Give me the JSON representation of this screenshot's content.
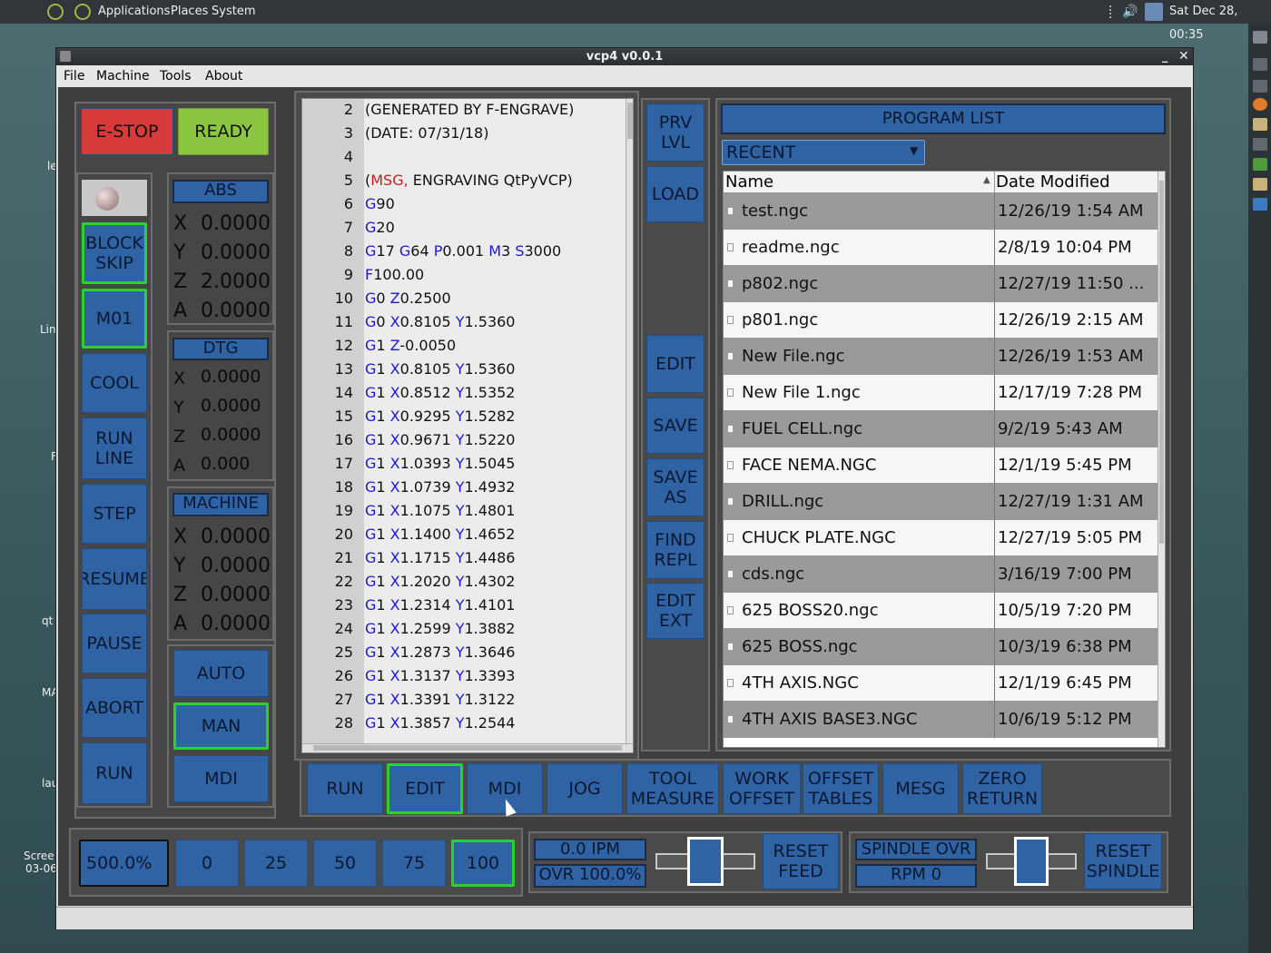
{
  "topbar": {
    "menus": [
      "Applications",
      "Places",
      "System"
    ],
    "clock": "Sat Dec 28, 00:35"
  },
  "desktop": {
    "labels": [
      "le",
      "Lin",
      "F",
      "qt",
      "MA",
      "lau",
      "Scree",
      "03-06"
    ]
  },
  "window": {
    "title": "vcp4 v0.0.1",
    "menus": [
      "File",
      "Machine",
      "Tools",
      "About"
    ]
  },
  "left": {
    "estop": "E-STOP",
    "ready": "READY",
    "buttons": [
      "BLOCK\nSKIP",
      "M01",
      "COOL",
      "RUN\nLINE",
      "STEP",
      "RESUME",
      "PAUSE",
      "ABORT",
      "RUN"
    ]
  },
  "dro": {
    "abs": {
      "title": "ABS",
      "rows": [
        [
          "X",
          "0.0000"
        ],
        [
          "Y",
          "0.0000"
        ],
        [
          "Z",
          "2.0000"
        ],
        [
          "A",
          "0.0000"
        ]
      ]
    },
    "dtg": {
      "title": "DTG",
      "rows": [
        [
          "X",
          "0.0000"
        ],
        [
          "Y",
          "0.0000"
        ],
        [
          "Z",
          "0.0000"
        ],
        [
          "A",
          "0.000"
        ]
      ]
    },
    "machine": {
      "title": "MACHINE",
      "rows": [
        [
          "X",
          "0.0000"
        ],
        [
          "Y",
          "0.0000"
        ],
        [
          "Z",
          "0.0000"
        ],
        [
          "A",
          "0.0000"
        ]
      ]
    }
  },
  "modes": [
    "AUTO",
    "MAN",
    "MDI"
  ],
  "gcode": [
    {
      "n": "2",
      "t": [
        [
          "",
          "(GENERATED BY F-ENGRAVE)"
        ]
      ]
    },
    {
      "n": "3",
      "t": [
        [
          "",
          "(DATE: 07/31/18)"
        ]
      ]
    },
    {
      "n": "4",
      "t": []
    },
    {
      "n": "5",
      "t": [
        [
          "",
          "("
        ],
        [
          "r",
          "MSG,"
        ],
        [
          "",
          " ENGRAVING QtPyVCP)"
        ]
      ]
    },
    {
      "n": "6",
      "t": [
        [
          "g",
          "G"
        ],
        [
          "",
          "90"
        ]
      ]
    },
    {
      "n": "7",
      "t": [
        [
          "g",
          "G"
        ],
        [
          "",
          "20"
        ]
      ]
    },
    {
      "n": "8",
      "t": [
        [
          "g",
          "G"
        ],
        [
          "",
          "17 "
        ],
        [
          "g",
          "G"
        ],
        [
          "",
          "64 "
        ],
        [
          "g",
          "P"
        ],
        [
          "",
          "0.001 "
        ],
        [
          "g",
          "M"
        ],
        [
          "",
          "3 "
        ],
        [
          "g",
          "S"
        ],
        [
          "",
          "3000"
        ]
      ]
    },
    {
      "n": "9",
      "t": [
        [
          "g",
          "F"
        ],
        [
          "",
          "100.00"
        ]
      ]
    },
    {
      "n": "10",
      "t": [
        [
          "g",
          "G"
        ],
        [
          "",
          "0 "
        ],
        [
          "g",
          "Z"
        ],
        [
          "",
          "0.2500"
        ]
      ]
    },
    {
      "n": "11",
      "t": [
        [
          "g",
          "G"
        ],
        [
          "",
          "0 "
        ],
        [
          "g",
          "X"
        ],
        [
          "",
          "0.8105 "
        ],
        [
          "g",
          "Y"
        ],
        [
          "",
          "1.5360"
        ]
      ]
    },
    {
      "n": "12",
      "t": [
        [
          "g",
          "G"
        ],
        [
          "",
          "1 "
        ],
        [
          "g",
          "Z"
        ],
        [
          "",
          "-0.0050"
        ]
      ]
    },
    {
      "n": "13",
      "t": [
        [
          "g",
          "G"
        ],
        [
          "",
          "1 "
        ],
        [
          "g",
          "X"
        ],
        [
          "",
          "0.8105 "
        ],
        [
          "g",
          "Y"
        ],
        [
          "",
          "1.5360"
        ]
      ]
    },
    {
      "n": "14",
      "t": [
        [
          "g",
          "G"
        ],
        [
          "",
          "1 "
        ],
        [
          "g",
          "X"
        ],
        [
          "",
          "0.8512 "
        ],
        [
          "g",
          "Y"
        ],
        [
          "",
          "1.5352"
        ]
      ]
    },
    {
      "n": "15",
      "t": [
        [
          "g",
          "G"
        ],
        [
          "",
          "1 "
        ],
        [
          "g",
          "X"
        ],
        [
          "",
          "0.9295 "
        ],
        [
          "g",
          "Y"
        ],
        [
          "",
          "1.5282"
        ]
      ]
    },
    {
      "n": "16",
      "t": [
        [
          "g",
          "G"
        ],
        [
          "",
          "1 "
        ],
        [
          "g",
          "X"
        ],
        [
          "",
          "0.9671 "
        ],
        [
          "g",
          "Y"
        ],
        [
          "",
          "1.5220"
        ]
      ]
    },
    {
      "n": "17",
      "t": [
        [
          "g",
          "G"
        ],
        [
          "",
          "1 "
        ],
        [
          "g",
          "X"
        ],
        [
          "",
          "1.0393 "
        ],
        [
          "g",
          "Y"
        ],
        [
          "",
          "1.5045"
        ]
      ]
    },
    {
      "n": "18",
      "t": [
        [
          "g",
          "G"
        ],
        [
          "",
          "1 "
        ],
        [
          "g",
          "X"
        ],
        [
          "",
          "1.0739 "
        ],
        [
          "g",
          "Y"
        ],
        [
          "",
          "1.4932"
        ]
      ]
    },
    {
      "n": "19",
      "t": [
        [
          "g",
          "G"
        ],
        [
          "",
          "1 "
        ],
        [
          "g",
          "X"
        ],
        [
          "",
          "1.1075 "
        ],
        [
          "g",
          "Y"
        ],
        [
          "",
          "1.4801"
        ]
      ]
    },
    {
      "n": "20",
      "t": [
        [
          "g",
          "G"
        ],
        [
          "",
          "1 "
        ],
        [
          "g",
          "X"
        ],
        [
          "",
          "1.1400 "
        ],
        [
          "g",
          "Y"
        ],
        [
          "",
          "1.4652"
        ]
      ]
    },
    {
      "n": "21",
      "t": [
        [
          "g",
          "G"
        ],
        [
          "",
          "1 "
        ],
        [
          "g",
          "X"
        ],
        [
          "",
          "1.1715 "
        ],
        [
          "g",
          "Y"
        ],
        [
          "",
          "1.4486"
        ]
      ]
    },
    {
      "n": "22",
      "t": [
        [
          "g",
          "G"
        ],
        [
          "",
          "1 "
        ],
        [
          "g",
          "X"
        ],
        [
          "",
          "1.2020 "
        ],
        [
          "g",
          "Y"
        ],
        [
          "",
          "1.4302"
        ]
      ]
    },
    {
      "n": "23",
      "t": [
        [
          "g",
          "G"
        ],
        [
          "",
          "1 "
        ],
        [
          "g",
          "X"
        ],
        [
          "",
          "1.2314 "
        ],
        [
          "g",
          "Y"
        ],
        [
          "",
          "1.4101"
        ]
      ]
    },
    {
      "n": "24",
      "t": [
        [
          "g",
          "G"
        ],
        [
          "",
          "1 "
        ],
        [
          "g",
          "X"
        ],
        [
          "",
          "1.2599 "
        ],
        [
          "g",
          "Y"
        ],
        [
          "",
          "1.3882"
        ]
      ]
    },
    {
      "n": "25",
      "t": [
        [
          "g",
          "G"
        ],
        [
          "",
          "1 "
        ],
        [
          "g",
          "X"
        ],
        [
          "",
          "1.2873 "
        ],
        [
          "g",
          "Y"
        ],
        [
          "",
          "1.3646"
        ]
      ]
    },
    {
      "n": "26",
      "t": [
        [
          "g",
          "G"
        ],
        [
          "",
          "1 "
        ],
        [
          "g",
          "X"
        ],
        [
          "",
          "1.3137 "
        ],
        [
          "g",
          "Y"
        ],
        [
          "",
          "1.3393"
        ]
      ]
    },
    {
      "n": "27",
      "t": [
        [
          "g",
          "G"
        ],
        [
          "",
          "1 "
        ],
        [
          "g",
          "X"
        ],
        [
          "",
          "1.3391 "
        ],
        [
          "g",
          "Y"
        ],
        [
          "",
          "1.3122"
        ]
      ]
    },
    {
      "n": "28",
      "t": [
        [
          "g",
          "G"
        ],
        [
          "",
          "1 "
        ],
        [
          "g",
          "X"
        ],
        [
          "",
          "1.3857 "
        ],
        [
          "g",
          "Y"
        ],
        [
          "",
          "1.2544"
        ]
      ]
    }
  ],
  "sidebtns": [
    "PRV\nLVL",
    "LOAD",
    "EDIT",
    "SAVE",
    "SAVE\nAS",
    "FIND\nREPL",
    "EDIT\nEXT"
  ],
  "program_list": {
    "title": "PROGRAM LIST",
    "filter": "RECENT",
    "col_name": "Name",
    "col_date": "Date Modified",
    "rows": [
      [
        "test.ngc",
        "12/26/19 1:54 AM"
      ],
      [
        "readme.ngc",
        "2/8/19 10:04 PM"
      ],
      [
        "p802.ngc",
        "12/27/19 11:50 ..."
      ],
      [
        "p801.ngc",
        "12/26/19 2:15 AM"
      ],
      [
        "New File.ngc",
        "12/26/19 1:53 AM"
      ],
      [
        "New File 1.ngc",
        "12/17/19 7:28 PM"
      ],
      [
        "FUEL CELL.ngc",
        "9/2/19 5:43 AM"
      ],
      [
        "FACE NEMA.NGC",
        "12/1/19 5:45 PM"
      ],
      [
        "DRILL.ngc",
        "12/27/19 1:31 AM"
      ],
      [
        "CHUCK PLATE.NGC",
        "12/27/19 5:05 PM"
      ],
      [
        "cds.ngc",
        "3/16/19 7:00 PM"
      ],
      [
        "625 BOSS20.ngc",
        "10/5/19 7:20 PM"
      ],
      [
        "625 BOSS.ngc",
        "10/3/19 6:38 PM"
      ],
      [
        "4TH AXIS.NGC",
        "12/1/19 6:45 PM"
      ],
      [
        "4TH AXIS BASE3.NGC",
        "10/6/19 5:12 PM"
      ]
    ]
  },
  "tabs": [
    "RUN",
    "EDIT",
    "MDI",
    "JOG",
    "TOOL\nMEASURE",
    "WORK\nOFFSET",
    "OFFSET\nTABLES",
    "MESG",
    "ZERO\nRETURN"
  ],
  "bottom": {
    "feed_pct": "500.0%",
    "presets": [
      "0",
      "25",
      "50",
      "75",
      "100"
    ],
    "ipm": "0.0  IPM",
    "ovr": "OVR 100.0%",
    "reset_feed": "RESET\nFEED",
    "spindle_ovr": "SPINDLE OVR",
    "rpm": "RPM 0",
    "reset_spindle": "RESET\nSPINDLE",
    "feed_slider_level": 0.5,
    "spindle_slider_level": 0.5
  },
  "colors": {
    "button": "#2f63a3",
    "active_border": "#29d22c",
    "estop": "#d63a3a",
    "ready": "#8bc640"
  }
}
